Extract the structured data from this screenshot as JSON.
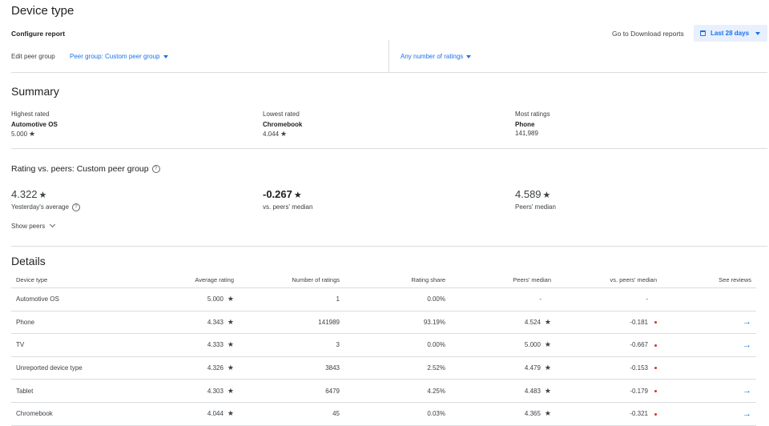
{
  "page": {
    "title": "Device type"
  },
  "config": {
    "title": "Configure report",
    "download_link": "Go to Download reports",
    "date_range": "Last 28 days",
    "edit_peer_label": "Edit peer group",
    "peer_group_select": "Peer group: Custom peer group",
    "ratings_filter": "Any number of ratings"
  },
  "summary": {
    "title": "Summary",
    "cards": [
      {
        "label": "Highest rated",
        "name": "Automotive OS",
        "value": "5.000"
      },
      {
        "label": "Lowest rated",
        "name": "Chromebook",
        "value": "4.044"
      },
      {
        "label": "Most ratings",
        "name": "Phone",
        "value": "141,989"
      }
    ]
  },
  "rating_vs_peers": {
    "title": "Rating vs. peers: Custom peer group",
    "yesterday_avg": {
      "value": "4.322",
      "label": "Yesterday's average"
    },
    "vs_median": {
      "value": "-0.267",
      "label": "vs. peers' median"
    },
    "peers_median": {
      "value": "4.589",
      "label": "Peers' median"
    },
    "show_peers": "Show peers"
  },
  "details": {
    "title": "Details",
    "headers": [
      "Device type",
      "Average rating",
      "Number of ratings",
      "Rating share",
      "Peers' median",
      "vs. peers' median",
      "See reviews"
    ],
    "rows": [
      {
        "device": "Automotive OS",
        "avg": "5.000",
        "count": "1",
        "share": "0.00%",
        "peers_median": "-",
        "vs": "-",
        "reviews": false
      },
      {
        "device": "Phone",
        "avg": "4.343",
        "count": "141989",
        "share": "93.19%",
        "peers_median": "4.524",
        "vs": "-0.181",
        "reviews": true
      },
      {
        "device": "TV",
        "avg": "4.333",
        "count": "3",
        "share": "0.00%",
        "peers_median": "5.000",
        "vs": "-0.667",
        "reviews": true
      },
      {
        "device": "Unreported device type",
        "avg": "4.326",
        "count": "3843",
        "share": "2.52%",
        "peers_median": "4.479",
        "vs": "-0.153",
        "reviews": false
      },
      {
        "device": "Tablet",
        "avg": "4.303",
        "count": "6479",
        "share": "4.25%",
        "peers_median": "4.483",
        "vs": "-0.179",
        "reviews": true
      },
      {
        "device": "Chromebook",
        "avg": "4.044",
        "count": "45",
        "share": "0.03%",
        "peers_median": "4.365",
        "vs": "-0.321",
        "reviews": true
      }
    ]
  }
}
